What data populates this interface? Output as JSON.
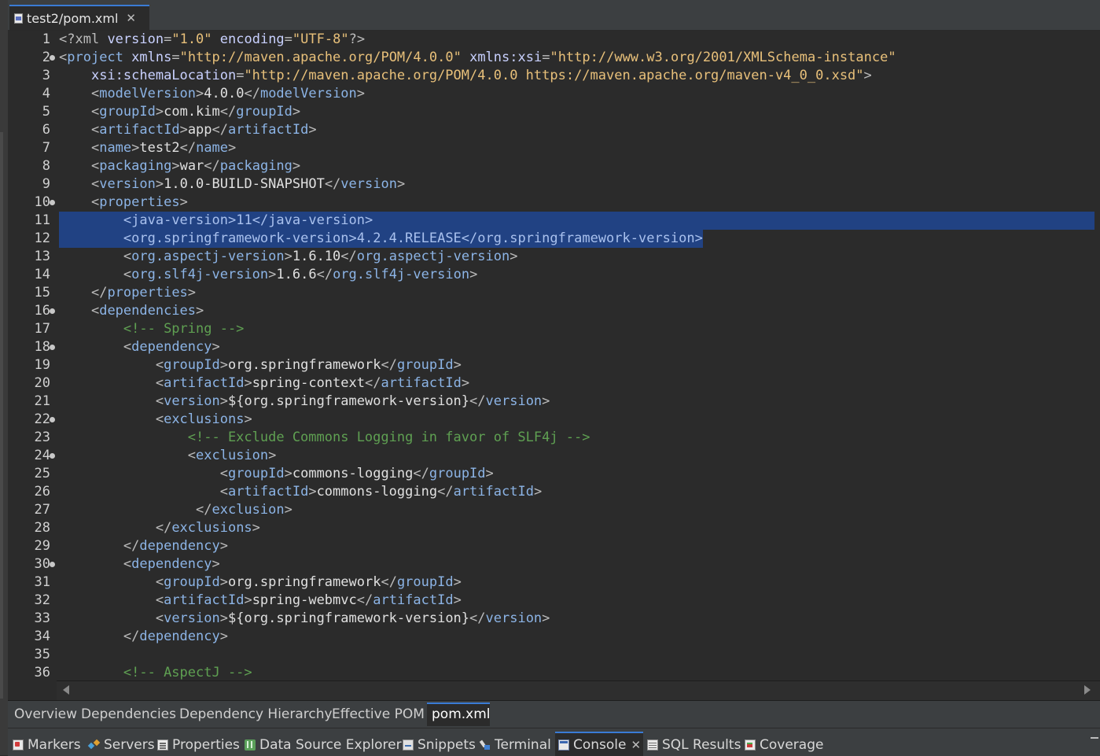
{
  "editor_tab": {
    "title": "test2/pom.xml",
    "close": "✕"
  },
  "editor": {
    "lines": [
      {
        "num": "1"
      },
      {
        "num": "2"
      },
      {
        "num": "3"
      },
      {
        "num": "4"
      },
      {
        "num": "5"
      },
      {
        "num": "6"
      },
      {
        "num": "7"
      },
      {
        "num": "8"
      },
      {
        "num": "9"
      },
      {
        "num": "10"
      },
      {
        "num": "11"
      },
      {
        "num": "12"
      },
      {
        "num": "13"
      },
      {
        "num": "14"
      },
      {
        "num": "15"
      },
      {
        "num": "16"
      },
      {
        "num": "17"
      },
      {
        "num": "18"
      },
      {
        "num": "19"
      },
      {
        "num": "20"
      },
      {
        "num": "21"
      },
      {
        "num": "22"
      },
      {
        "num": "23"
      },
      {
        "num": "24"
      },
      {
        "num": "25"
      },
      {
        "num": "26"
      },
      {
        "num": "27"
      },
      {
        "num": "28"
      },
      {
        "num": "29"
      },
      {
        "num": "30"
      },
      {
        "num": "31"
      },
      {
        "num": "32"
      },
      {
        "num": "33"
      },
      {
        "num": "34"
      },
      {
        "num": "35"
      },
      {
        "num": "36"
      }
    ],
    "selected_lines": [
      "11",
      "12"
    ],
    "foldable_lines": [
      "2",
      "10",
      "16",
      "18",
      "22",
      "24",
      "30"
    ]
  },
  "code": {
    "xml_decl_open": "<?xml",
    "version_attr": "version",
    "version_val": "\"1.0\"",
    "encoding_attr": "encoding",
    "encoding_val": "\"UTF-8\"",
    "xml_decl_close": "?>",
    "project": "project",
    "xmlns_attr": "xmlns",
    "xmlns_val": "\"http://maven.apache.org/POM/4.0.0\"",
    "xmlns_xsi_attr": "xmlns:xsi",
    "xmlns_xsi_val": "\"http://www.w3.org/2001/XMLSchema-instance\"",
    "schema_attr": "xsi:schemaLocation",
    "schema_val": "\"http://maven.apache.org/POM/4.0.0 https://maven.apache.org/maven-v4_0_0.xsd\"",
    "modelVersion": "modelVersion",
    "model_version_val": "4.0.0",
    "groupId": "groupId",
    "group_id_val": "com.kim",
    "artifactId": "artifactId",
    "artifact_id_val": "app",
    "name": "name",
    "name_val": "test2",
    "packaging": "packaging",
    "packaging_val": "war",
    "version": "version",
    "version_val_text": "1.0.0-BUILD-SNAPSHOT",
    "properties": "properties",
    "java_version": "java-version",
    "java_version_val": "11",
    "spring_version": "org.springframework-version",
    "spring_version_val": "4.2.4.RELEASE",
    "aspectj_version": "org.aspectj-version",
    "aspectj_version_val": "1.6.10",
    "slf4j_version": "org.slf4j-version",
    "slf4j_version_val": "1.6.6",
    "dependencies": "dependencies",
    "comment_spring": "<!-- Spring -->",
    "dependency": "dependency",
    "org_springframework": "org.springframework",
    "spring_context": "spring-context",
    "spring_version_ref": "${org.springframework-version}",
    "exclusions": "exclusions",
    "comment_exclude": "<!-- Exclude Commons Logging in favor of SLF4j -->",
    "exclusion": "exclusion",
    "commons_logging": "commons-logging",
    "spring_webmvc": "spring-webmvc",
    "comment_aspectj": "<!-- AspectJ -->"
  },
  "page_tabs": [
    "Overview",
    "Dependencies",
    "Dependency Hierarchy",
    "Effective POM",
    "pom.xml"
  ],
  "active_page_tab": "pom.xml",
  "view_tabs": [
    {
      "label": "Markers",
      "icon": "markers-icon"
    },
    {
      "label": "Servers",
      "icon": "servers-icon"
    },
    {
      "label": "Properties",
      "icon": "properties-icon"
    },
    {
      "label": "Data Source Explorer",
      "icon": "data-source-explorer-icon"
    },
    {
      "label": "Snippets",
      "icon": "snippets-icon"
    },
    {
      "label": "Terminal",
      "icon": "terminal-icon"
    },
    {
      "label": "Console",
      "icon": "console-icon"
    },
    {
      "label": "SQL Results",
      "icon": "sql-results-icon"
    },
    {
      "label": "Coverage",
      "icon": "coverage-icon"
    }
  ],
  "active_view_tab": "Console",
  "view_close": "✕",
  "colors": {
    "background": "#2b2b2b",
    "selection": "#214283",
    "tag": "#8cb4e6",
    "attribute_value": "#e8c07a",
    "comment": "#5fa052",
    "active_tab_accent": "#3a7bd5"
  }
}
